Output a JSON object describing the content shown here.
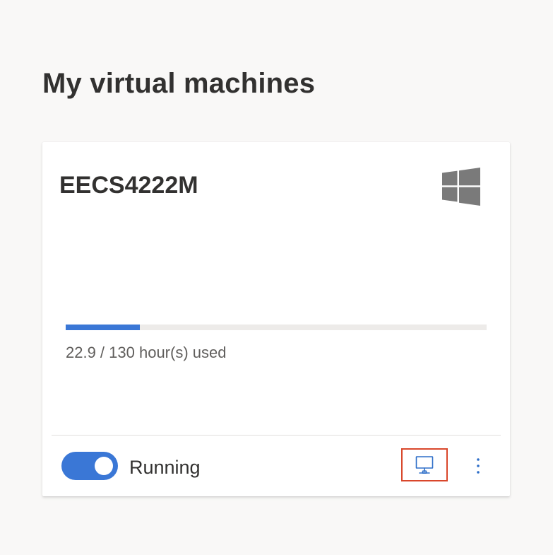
{
  "page": {
    "title": "My virtual machines"
  },
  "vm_card": {
    "name": "EECS4222M",
    "os": "windows-logo-icon",
    "usage": {
      "used_hours": 22.9,
      "total_hours": 130,
      "text": "22.9 / 130 hour(s) used"
    },
    "status": "Running",
    "toggle_on": true,
    "actions": {
      "connect_icon": "remote-desktop-icon",
      "more_icon": "more-vertical-icon"
    }
  },
  "colors": {
    "accent": "#3a77d6",
    "logo_gray": "#7a7a7a",
    "highlight_border": "#d9472b",
    "track": "#edebe9",
    "background": "#f9f8f7"
  }
}
